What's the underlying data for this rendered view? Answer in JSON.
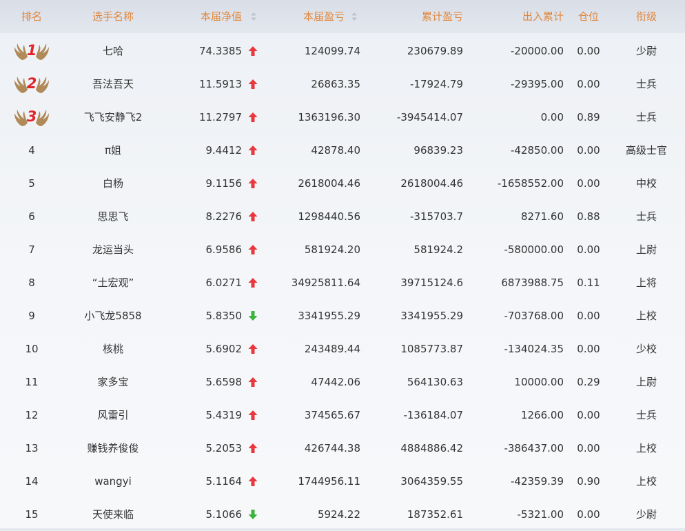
{
  "header": {
    "rank": "排名",
    "name": "选手名称",
    "nav": "本届净值",
    "pl": "本届盈亏",
    "cum": "累计盈亏",
    "flow": "出入累计",
    "pos": "仓位",
    "title": "衔级"
  },
  "colors": {
    "header_text": "#e0873b",
    "arrow_up": "#e8383d",
    "arrow_down": "#3cb33c",
    "medal_number": "#e0252a",
    "wing": "#b08a58"
  },
  "rows": [
    {
      "rank": "1",
      "medal": true,
      "name": "七哈",
      "nav": "74.3385",
      "trend": "up",
      "pl": "124099.74",
      "cum": "230679.89",
      "flow": "-20000.00",
      "pos": "0.00",
      "title": "少尉"
    },
    {
      "rank": "2",
      "medal": true,
      "name": "吾法吾天",
      "nav": "11.5913",
      "trend": "up",
      "pl": "26863.35",
      "cum": "-17924.79",
      "flow": "-29395.00",
      "pos": "0.00",
      "title": "士兵"
    },
    {
      "rank": "3",
      "medal": true,
      "name": "飞飞安静飞2",
      "nav": "11.2797",
      "trend": "up",
      "pl": "1363196.30",
      "cum": "-3945414.07",
      "flow": "0.00",
      "pos": "0.89",
      "title": "士兵"
    },
    {
      "rank": "4",
      "medal": false,
      "name": "π姐",
      "nav": "9.4412",
      "trend": "up",
      "pl": "42878.40",
      "cum": "96839.23",
      "flow": "-42850.00",
      "pos": "0.00",
      "title": "高级士官"
    },
    {
      "rank": "5",
      "medal": false,
      "name": "白杨",
      "nav": "9.1156",
      "trend": "up",
      "pl": "2618004.46",
      "cum": "2618004.46",
      "flow": "-1658552.00",
      "pos": "0.00",
      "title": "中校"
    },
    {
      "rank": "6",
      "medal": false,
      "name": "思思飞",
      "nav": "8.2276",
      "trend": "up",
      "pl": "1298440.56",
      "cum": "-315703.7",
      "flow": "8271.60",
      "pos": "0.88",
      "title": "士兵"
    },
    {
      "rank": "7",
      "medal": false,
      "name": "龙运当头",
      "nav": "6.9586",
      "trend": "up",
      "pl": "581924.20",
      "cum": "581924.2",
      "flow": "-580000.00",
      "pos": "0.00",
      "title": "上尉"
    },
    {
      "rank": "8",
      "medal": false,
      "name": "“土宏观”",
      "nav": "6.0271",
      "trend": "up",
      "pl": "34925811.64",
      "cum": "39715124.6",
      "flow": "6873988.75",
      "pos": "0.11",
      "title": "上将"
    },
    {
      "rank": "9",
      "medal": false,
      "name": "小飞龙5858",
      "nav": "5.8350",
      "trend": "down",
      "pl": "3341955.29",
      "cum": "3341955.29",
      "flow": "-703768.00",
      "pos": "0.00",
      "title": "上校"
    },
    {
      "rank": "10",
      "medal": false,
      "name": "核桃",
      "nav": "5.6902",
      "trend": "up",
      "pl": "243489.44",
      "cum": "1085773.87",
      "flow": "-134024.35",
      "pos": "0.00",
      "title": "少校"
    },
    {
      "rank": "11",
      "medal": false,
      "name": "家多宝",
      "nav": "5.6598",
      "trend": "up",
      "pl": "47442.06",
      "cum": "564130.63",
      "flow": "10000.00",
      "pos": "0.29",
      "title": "上尉"
    },
    {
      "rank": "12",
      "medal": false,
      "name": "风雷引",
      "nav": "5.4319",
      "trend": "up",
      "pl": "374565.67",
      "cum": "-136184.07",
      "flow": "1266.00",
      "pos": "0.00",
      "title": "士兵"
    },
    {
      "rank": "13",
      "medal": false,
      "name": "赚钱养俊俊",
      "nav": "5.2053",
      "trend": "up",
      "pl": "426744.38",
      "cum": "4884886.42",
      "flow": "-386437.00",
      "pos": "0.00",
      "title": "上校"
    },
    {
      "rank": "14",
      "medal": false,
      "name": "wangyi",
      "nav": "5.1164",
      "trend": "up",
      "pl": "1744956.11",
      "cum": "3064359.55",
      "flow": "-42359.39",
      "pos": "0.90",
      "title": "上校"
    },
    {
      "rank": "15",
      "medal": false,
      "name": "天使来临",
      "nav": "5.1066",
      "trend": "down",
      "pl": "5924.22",
      "cum": "187352.61",
      "flow": "-5321.00",
      "pos": "0.00",
      "title": "少尉"
    }
  ]
}
